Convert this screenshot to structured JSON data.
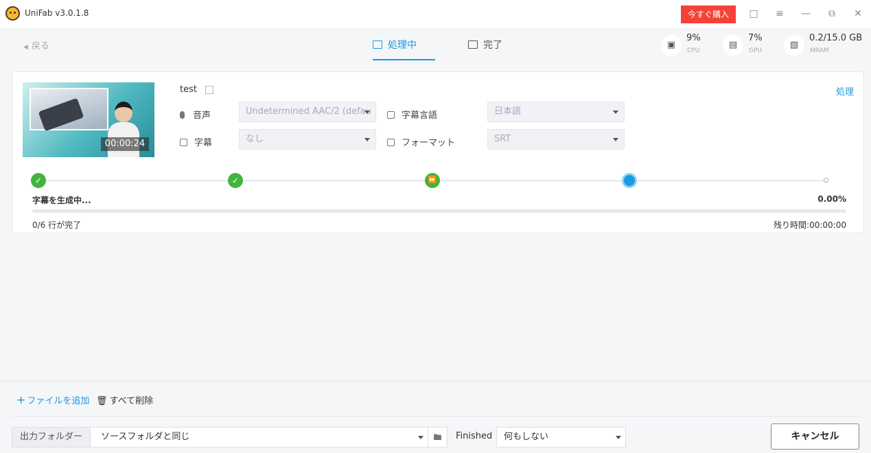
{
  "app": {
    "title": "UniFab v3.0.1.8",
    "buy_label": "今すぐ購入",
    "accent": "#1a9ae0",
    "buy_color": "#f44336"
  },
  "titlebar_icons": [
    "shirt-icon",
    "menu-icon",
    "minimize-icon",
    "restore-icon",
    "close-icon"
  ],
  "nav": {
    "back_label": "戻る",
    "tabs": [
      {
        "label": "処理中",
        "active": true
      },
      {
        "label": "完了",
        "active": false
      }
    ]
  },
  "stats": {
    "cpu": {
      "value": "9%",
      "label": "CPU"
    },
    "gpu": {
      "value": "7%",
      "label": "GPU"
    },
    "vram": {
      "value": "0.2/15.0 GB",
      "label": "MRAM"
    }
  },
  "task": {
    "thumbnail_time": "00:00:24",
    "file_name": "test",
    "process_label": "処理",
    "audio_label": "音声",
    "audio_value": "Undetermined AAC/2 (defau",
    "subtitle_lang_label": "字幕言語",
    "subtitle_lang_value": "日本語",
    "subtitle_label": "字幕",
    "subtitle_value": "なし",
    "format_label": "フォーマット",
    "format_value": "SRT",
    "steps": [
      "done",
      "done",
      "done",
      "active",
      "pending"
    ],
    "status_text": "字幕を生成中...",
    "percent_text": "0.00%",
    "progress": 0,
    "lines_done": "0/6 行が完了",
    "remaining": "残り時間:00:00:00"
  },
  "bottom": {
    "add_file": "ファイルを追加",
    "delete_all": "すべて削除",
    "output_folder_label": "出力フォルダー",
    "output_folder_value": "ソースフォルダと同じ",
    "finished_label": "Finished",
    "finished_value": "何もしない",
    "cancel_label": "キャンセル"
  }
}
